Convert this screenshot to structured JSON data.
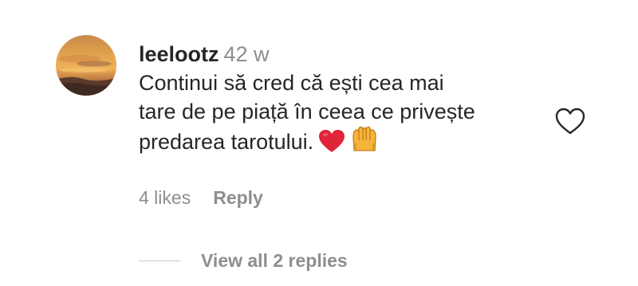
{
  "comment": {
    "avatar_icon": "sunset-profile-avatar",
    "username": "leelootz",
    "timestamp": "42 w",
    "text_lines": [
      "Continui să cred că ești cea mai",
      "tare de pe piață în ceea ce privește",
      "predarea tarotului."
    ],
    "emojis": [
      "red-heart-emoji",
      "raising-hands-emoji"
    ],
    "likes": "4 likes",
    "reply_label": "Reply",
    "like_icon": "heart-outline-icon",
    "view_replies_label": "View all 2 replies"
  },
  "colors": {
    "text_primary": "#262626",
    "text_secondary": "#8e8e8e",
    "divider": "#c7c7c7",
    "heart_emoji": "#e0243a"
  }
}
